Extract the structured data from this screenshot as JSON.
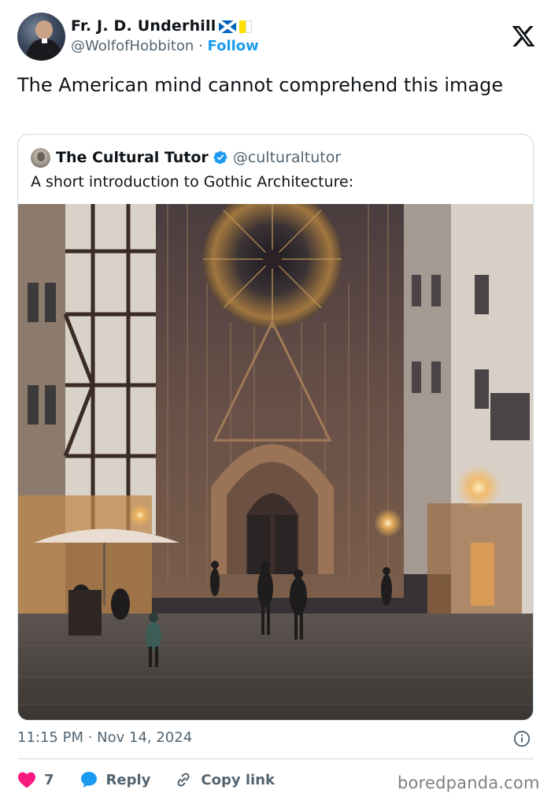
{
  "post": {
    "author": {
      "name": "Fr. J. D. Underhill",
      "handle": "@WolfofHobbiton",
      "separator": "·",
      "follow_label": "Follow",
      "flags": [
        "scotland-flag-icon",
        "vatican-flag-icon"
      ]
    },
    "text": "The American mind cannot comprehend this image",
    "timestamp": "11:15 PM · Nov 14, 2024"
  },
  "quoted_post": {
    "name": "The Cultural Tutor",
    "handle": "@culturaltutor",
    "verified": true,
    "text": "A short introduction to Gothic Architecture:",
    "image": "cathedral-street-night-photo"
  },
  "actions": {
    "like_count": "7",
    "reply_label": "Reply",
    "copy_label": "Copy link"
  },
  "watermark": "boredpanda.com",
  "colors": {
    "accent": "#1d9bf0",
    "like": "#f91880",
    "text": "#0f1419",
    "muted": "#536471",
    "border": "#cfd9de"
  }
}
